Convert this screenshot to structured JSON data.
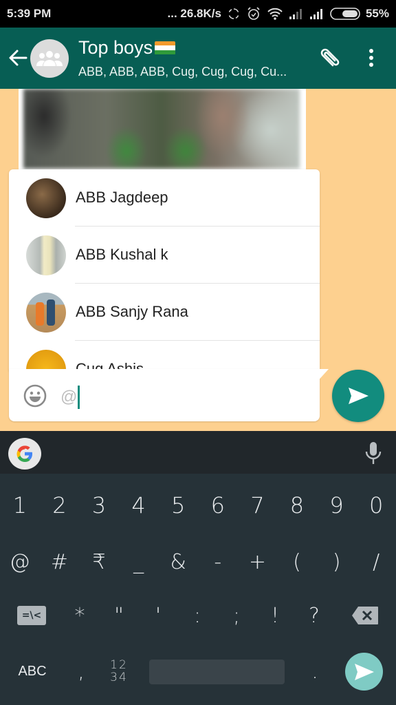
{
  "status_bar": {
    "time": "5:39 PM",
    "network_speed": "... 26.8K/s",
    "battery_percent": "55%",
    "battery_level": 0.55,
    "icons": [
      "sync-icon",
      "alarm-icon",
      "wifi-icon",
      "signal-icon",
      "signal-icon",
      "battery-icon"
    ]
  },
  "header": {
    "back_icon": "arrow-left-icon",
    "avatar_icon": "group-icon",
    "title": "Top boys",
    "title_emoji": "india-flag",
    "subtitle": "ABB, ABB, ABB, Cug, Cug, Cug, Cu...",
    "actions": [
      "paperclip-icon",
      "more-vert-icon"
    ]
  },
  "colors": {
    "header": "#075e54",
    "accent": "#128c7e",
    "chat_background": "#fdd08f",
    "keyboard": "#263238"
  },
  "mentions": [
    {
      "name": "ABB Jagdeep"
    },
    {
      "name": "ABB Kushal k"
    },
    {
      "name": "ABB Sanjy Rana"
    },
    {
      "name": "Cug Ashis"
    }
  ],
  "composer": {
    "value": "@",
    "emoji_icon": "smiley-icon",
    "send_icon": "send-icon"
  },
  "keyboard": {
    "suggestion_bar": {
      "left": "google-g-icon",
      "right": "mic-icon"
    },
    "row1": [
      "1",
      "2",
      "3",
      "4",
      "5",
      "6",
      "7",
      "8",
      "9",
      "0"
    ],
    "row2": [
      "@",
      "#",
      "₹",
      "_",
      "&",
      "-",
      "+",
      "(",
      ")",
      "/"
    ],
    "row3": {
      "shift_label": "=\\<",
      "keys": [
        "*",
        "\"",
        "'",
        ":",
        ";",
        "!",
        "?"
      ],
      "delete_icon": "backspace-icon"
    },
    "row4": {
      "abc_label": "ABC",
      "comma": ",",
      "num_top": "12",
      "num_bottom": "34",
      "period": ".",
      "enter_icon": "send-icon"
    }
  }
}
